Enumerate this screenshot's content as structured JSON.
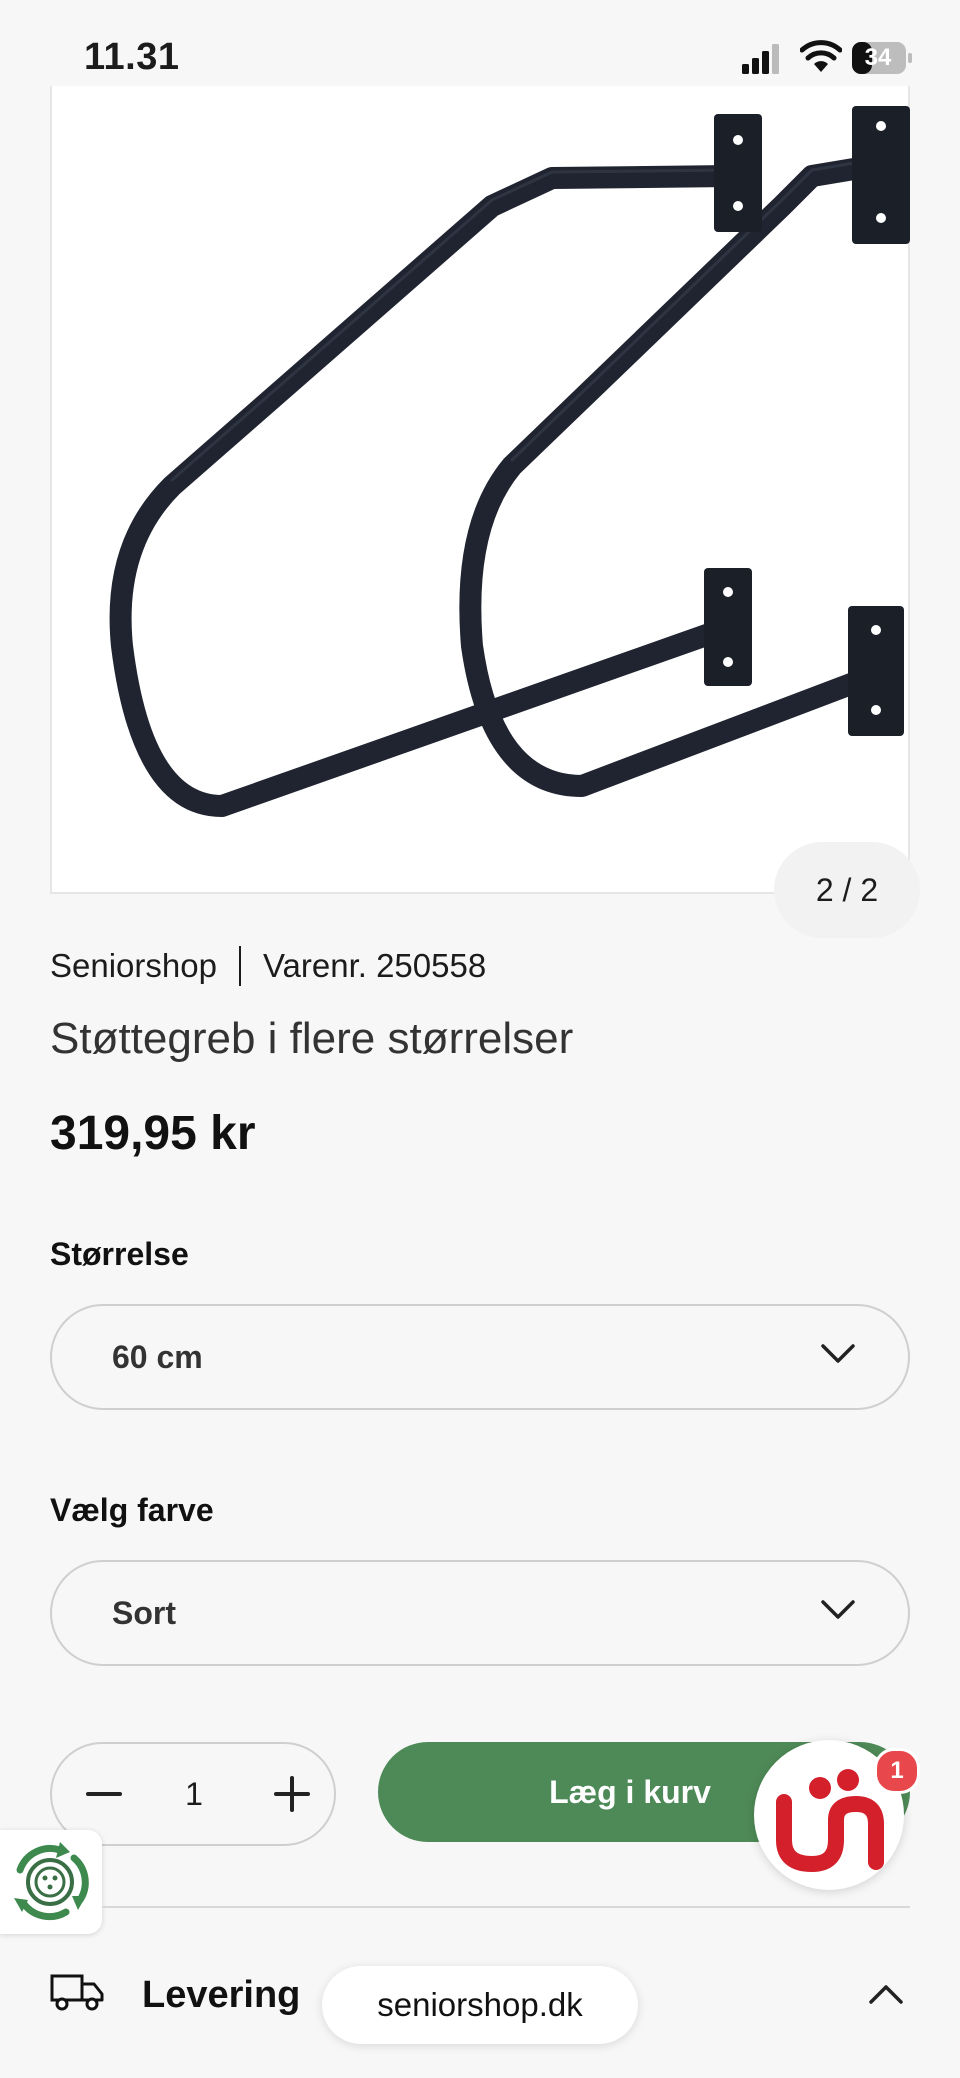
{
  "status_bar": {
    "time": "11.31",
    "battery": "34"
  },
  "gallery": {
    "counter": "2 / 2"
  },
  "product": {
    "brand": "Seniorshop",
    "sku": "Varenr. 250558",
    "title": "Støttegreb i flere størrelser",
    "price": "319,95 kr"
  },
  "options": {
    "size_label": "Størrelse",
    "size_value": "60 cm",
    "color_label": "Vælg farve",
    "color_value": "Sort"
  },
  "cart": {
    "quantity": "1",
    "add_label": "Læg i kurv"
  },
  "chat": {
    "badge_count": "1"
  },
  "delivery": {
    "label": "Levering"
  },
  "browser": {
    "url": "seniorshop.dk"
  },
  "icons": [
    "signal-icon",
    "wifi-icon",
    "battery-icon",
    "chevron-down-icon",
    "minus-icon",
    "plus-icon",
    "truck-icon",
    "chevron-up-icon",
    "recycle-icon",
    "chat-logo-icon"
  ],
  "colors": {
    "accent_green": "#4e8a57",
    "badge_red": "#e8474b",
    "background": "#f7f7f7"
  }
}
